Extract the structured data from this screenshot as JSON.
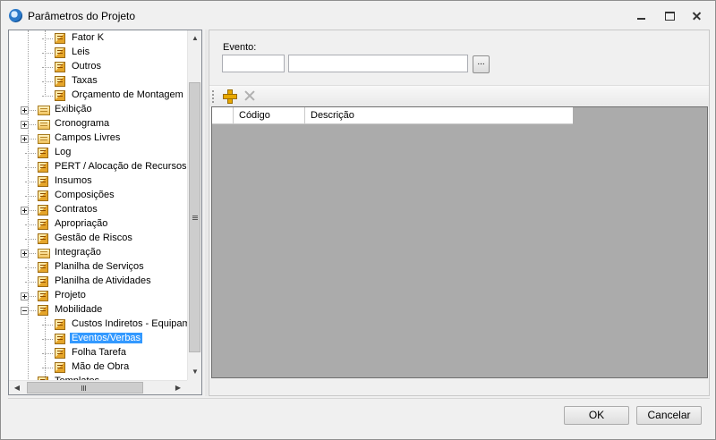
{
  "window": {
    "title": "Parâmetros do Projeto",
    "icon": "app-logo-icon"
  },
  "tree": {
    "items": [
      {
        "label": "Fator K",
        "level": 2,
        "expander": "none",
        "icon": "node-icon"
      },
      {
        "label": "Leis",
        "level": 2,
        "expander": "none",
        "icon": "node-icon"
      },
      {
        "label": "Outros",
        "level": 2,
        "expander": "none",
        "icon": "node-icon"
      },
      {
        "label": "Taxas",
        "level": 2,
        "expander": "none",
        "icon": "node-icon"
      },
      {
        "label": "Orçamento de Montagem",
        "level": 2,
        "expander": "none",
        "icon": "node-icon"
      },
      {
        "label": "Exibição",
        "level": 1,
        "expander": "plus",
        "icon": "folder-icon"
      },
      {
        "label": "Cronograma",
        "level": 1,
        "expander": "plus",
        "icon": "folder-icon"
      },
      {
        "label": "Campos Livres",
        "level": 1,
        "expander": "plus",
        "icon": "folder-icon"
      },
      {
        "label": "Log",
        "level": 1,
        "expander": "none",
        "icon": "node-icon"
      },
      {
        "label": "PERT / Alocação de Recursos",
        "level": 1,
        "expander": "none",
        "icon": "node-icon"
      },
      {
        "label": "Insumos",
        "level": 1,
        "expander": "none",
        "icon": "node-icon"
      },
      {
        "label": "Composições",
        "level": 1,
        "expander": "none",
        "icon": "node-icon"
      },
      {
        "label": "Contratos",
        "level": 1,
        "expander": "plus",
        "icon": "node-icon"
      },
      {
        "label": "Apropriação",
        "level": 1,
        "expander": "none",
        "icon": "node-icon"
      },
      {
        "label": "Gestão de Riscos",
        "level": 1,
        "expander": "none",
        "icon": "node-icon"
      },
      {
        "label": "Integração",
        "level": 1,
        "expander": "plus",
        "icon": "folder-icon"
      },
      {
        "label": "Planilha de Serviços",
        "level": 1,
        "expander": "none",
        "icon": "node-icon"
      },
      {
        "label": "Planilha de Atividades",
        "level": 1,
        "expander": "none",
        "icon": "node-icon"
      },
      {
        "label": "Projeto",
        "level": 1,
        "expander": "plus",
        "icon": "node-icon"
      },
      {
        "label": "Mobilidade",
        "level": 1,
        "expander": "minus",
        "icon": "node-icon"
      },
      {
        "label": "Custos Indiretos - Equipamentos",
        "level": 2,
        "expander": "none",
        "icon": "node-icon"
      },
      {
        "label": "Eventos/Verbas",
        "level": 2,
        "expander": "none",
        "icon": "node-icon",
        "selected": true
      },
      {
        "label": "Folha Tarefa",
        "level": 2,
        "expander": "none",
        "icon": "node-icon"
      },
      {
        "label": "Mão de Obra",
        "level": 2,
        "expander": "none",
        "icon": "node-icon"
      },
      {
        "label": "Templates",
        "level": 1,
        "expander": "none",
        "icon": "node-icon"
      }
    ],
    "scroll_h_grip": "III"
  },
  "evento": {
    "label": "Evento:",
    "code_value": "",
    "description_value": "",
    "lookup_label": "..."
  },
  "toolbar": {
    "add_icon": "add-icon",
    "delete_icon": "delete-icon"
  },
  "grid": {
    "columns": [
      "Código",
      "Descrição"
    ],
    "rows": []
  },
  "buttons": {
    "ok": "OK",
    "cancel": "Cancelar"
  }
}
